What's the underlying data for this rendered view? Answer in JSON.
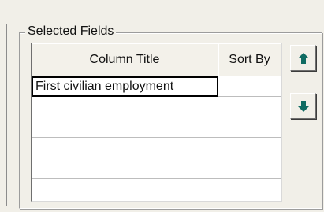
{
  "selected_fields": {
    "legend": "Selected Fields",
    "columns": {
      "title": "Column Title",
      "sort": "Sort By"
    },
    "rows": [
      {
        "title": "First civilian employment",
        "sort": ""
      },
      {
        "title": "",
        "sort": ""
      },
      {
        "title": "",
        "sort": ""
      },
      {
        "title": "",
        "sort": ""
      },
      {
        "title": "",
        "sort": ""
      },
      {
        "title": "",
        "sort": ""
      },
      {
        "title": "",
        "sort": ""
      }
    ]
  },
  "buttons": {
    "up": "arrow-up-icon",
    "down": "arrow-down-icon"
  },
  "colors": {
    "arrow": "#0f6b62",
    "window_bg": "#f1efe8"
  }
}
